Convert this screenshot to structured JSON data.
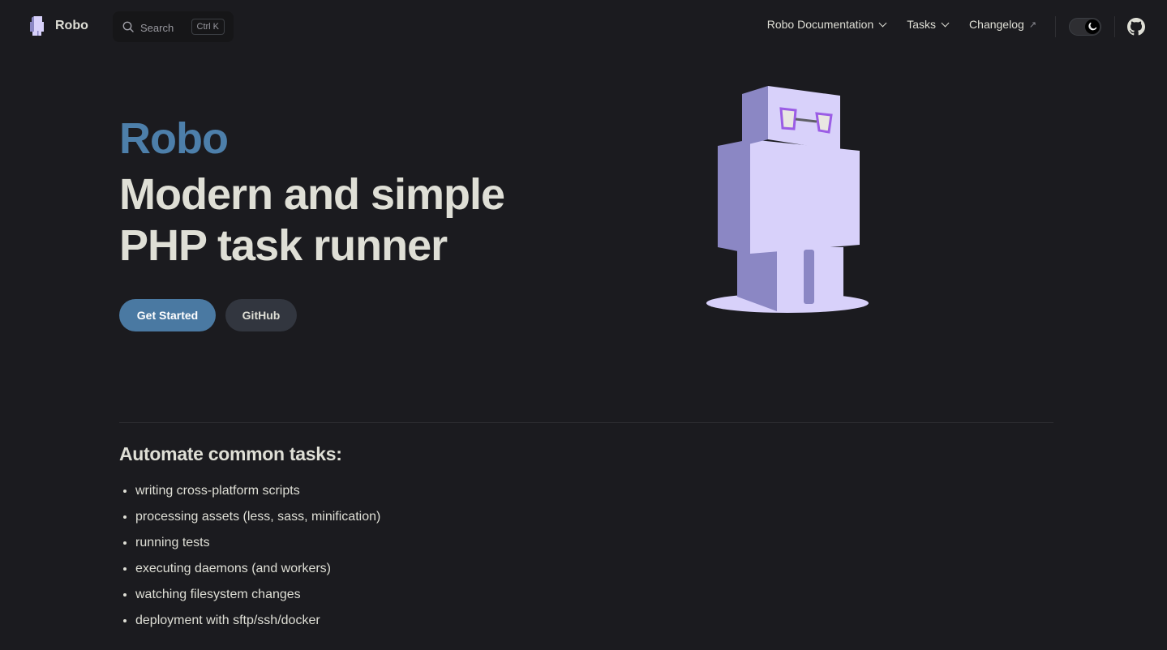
{
  "nav": {
    "logo_title": "Robo",
    "search": {
      "label": "Search",
      "shortcut": "Ctrl K"
    },
    "menu": [
      {
        "label": "Robo Documentation",
        "has_dropdown": true
      },
      {
        "label": "Tasks",
        "has_dropdown": true
      },
      {
        "label": "Changelog",
        "external_mark": "↗"
      }
    ],
    "icons": {
      "search": "search-icon",
      "theme": "moon-icon",
      "social": "github-icon"
    }
  },
  "hero": {
    "name": "Robo",
    "text": "Modern and simple PHP task runner",
    "actions": [
      {
        "label": "Get Started",
        "theme": "brand"
      },
      {
        "label": "GitHub",
        "theme": "alt"
      }
    ]
  },
  "content": {
    "title": "Automate common tasks:",
    "items": [
      "writing cross-platform scripts",
      "processing assets (less, sass, minification)",
      "running tests",
      "executing daemons (and workers)",
      "watching filesystem changes",
      "deployment with sftp/ssh/docker"
    ]
  },
  "colors": {
    "background": "#1b1b1f",
    "brand": "#4d7faa",
    "text": "#dfdfd6",
    "robot_light": "#d8d1fa",
    "robot_shade": "#8b87c4",
    "glasses": "#9b5de5"
  }
}
